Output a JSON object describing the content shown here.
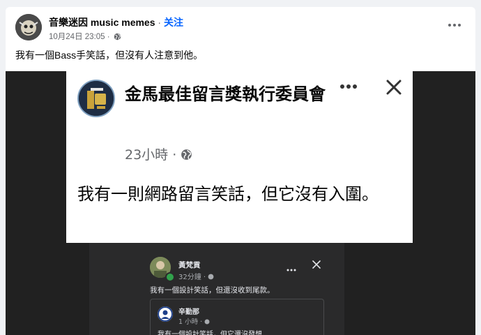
{
  "post": {
    "page_name": "音樂迷因 music memes",
    "separator": " · ",
    "follow_label": "关注",
    "timestamp": "10月24日 23:05",
    "time_separator": " · ",
    "privacy_icon": "globe-icon",
    "more_icon": "more-options-icon",
    "caption": "我有一個Bass手笑話，但沒有人注意到他。"
  },
  "screenshot": {
    "title": "金馬最佳留言獎執行委員會",
    "time": "23小時 · ",
    "body": "我有一則網路留言笑話，但它沒有入圍。",
    "icons": [
      "more-options-icon",
      "close-icon",
      "globe-icon"
    ]
  },
  "comment": {
    "name": "黃梵貢",
    "time": "32分鐘 · ",
    "text": "我有一個設計笑話，但還沒收到尾款。",
    "reply": {
      "name": "辛勤那",
      "time": "1 小時 · ",
      "text": "我有一個設計笑話，但它還沒發想"
    }
  },
  "colors": {
    "follow": "#0866ff",
    "media_bg": "#212121",
    "online": "#31a24c"
  }
}
